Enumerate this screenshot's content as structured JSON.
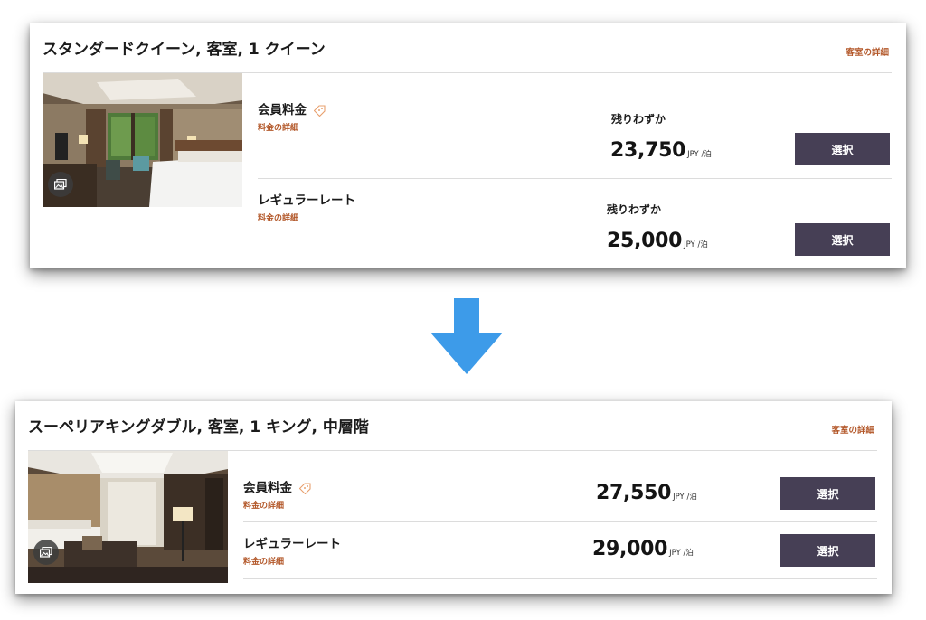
{
  "top_card": {
    "title": "スタンダードクイーン, 客室, 1 クイーン",
    "details_link": "客室の詳細",
    "rates": [
      {
        "name": "会員料金",
        "details_link": "料金の詳細",
        "availability": "残りわずか",
        "price": "23,750",
        "unit": "JPY /泊",
        "select_label": "選択",
        "has_member_tag": true
      },
      {
        "name": "レギュラーレート",
        "details_link": "料金の詳細",
        "availability": "残りわずか",
        "price": "25,000",
        "unit": "JPY /泊",
        "select_label": "選択",
        "has_member_tag": false
      }
    ]
  },
  "bottom_card": {
    "title": "スーペリアキングダブル, 客室, 1 キング, 中層階",
    "details_link": "客室の詳細",
    "rates": [
      {
        "name": "会員料金",
        "details_link": "料金の詳細",
        "price": "27,550",
        "unit": "JPY /泊",
        "select_label": "選択",
        "has_member_tag": true
      },
      {
        "name": "レギュラーレート",
        "details_link": "料金の詳細",
        "price": "29,000",
        "unit": "JPY /泊",
        "select_label": "選択",
        "has_member_tag": false
      }
    ]
  },
  "colors": {
    "accent_link": "#b3582a",
    "select_button": "#463f55",
    "arrow": "#3d9be9"
  },
  "icons": [
    "gallery-icon",
    "member-tag-icon",
    "down-arrow-icon"
  ]
}
